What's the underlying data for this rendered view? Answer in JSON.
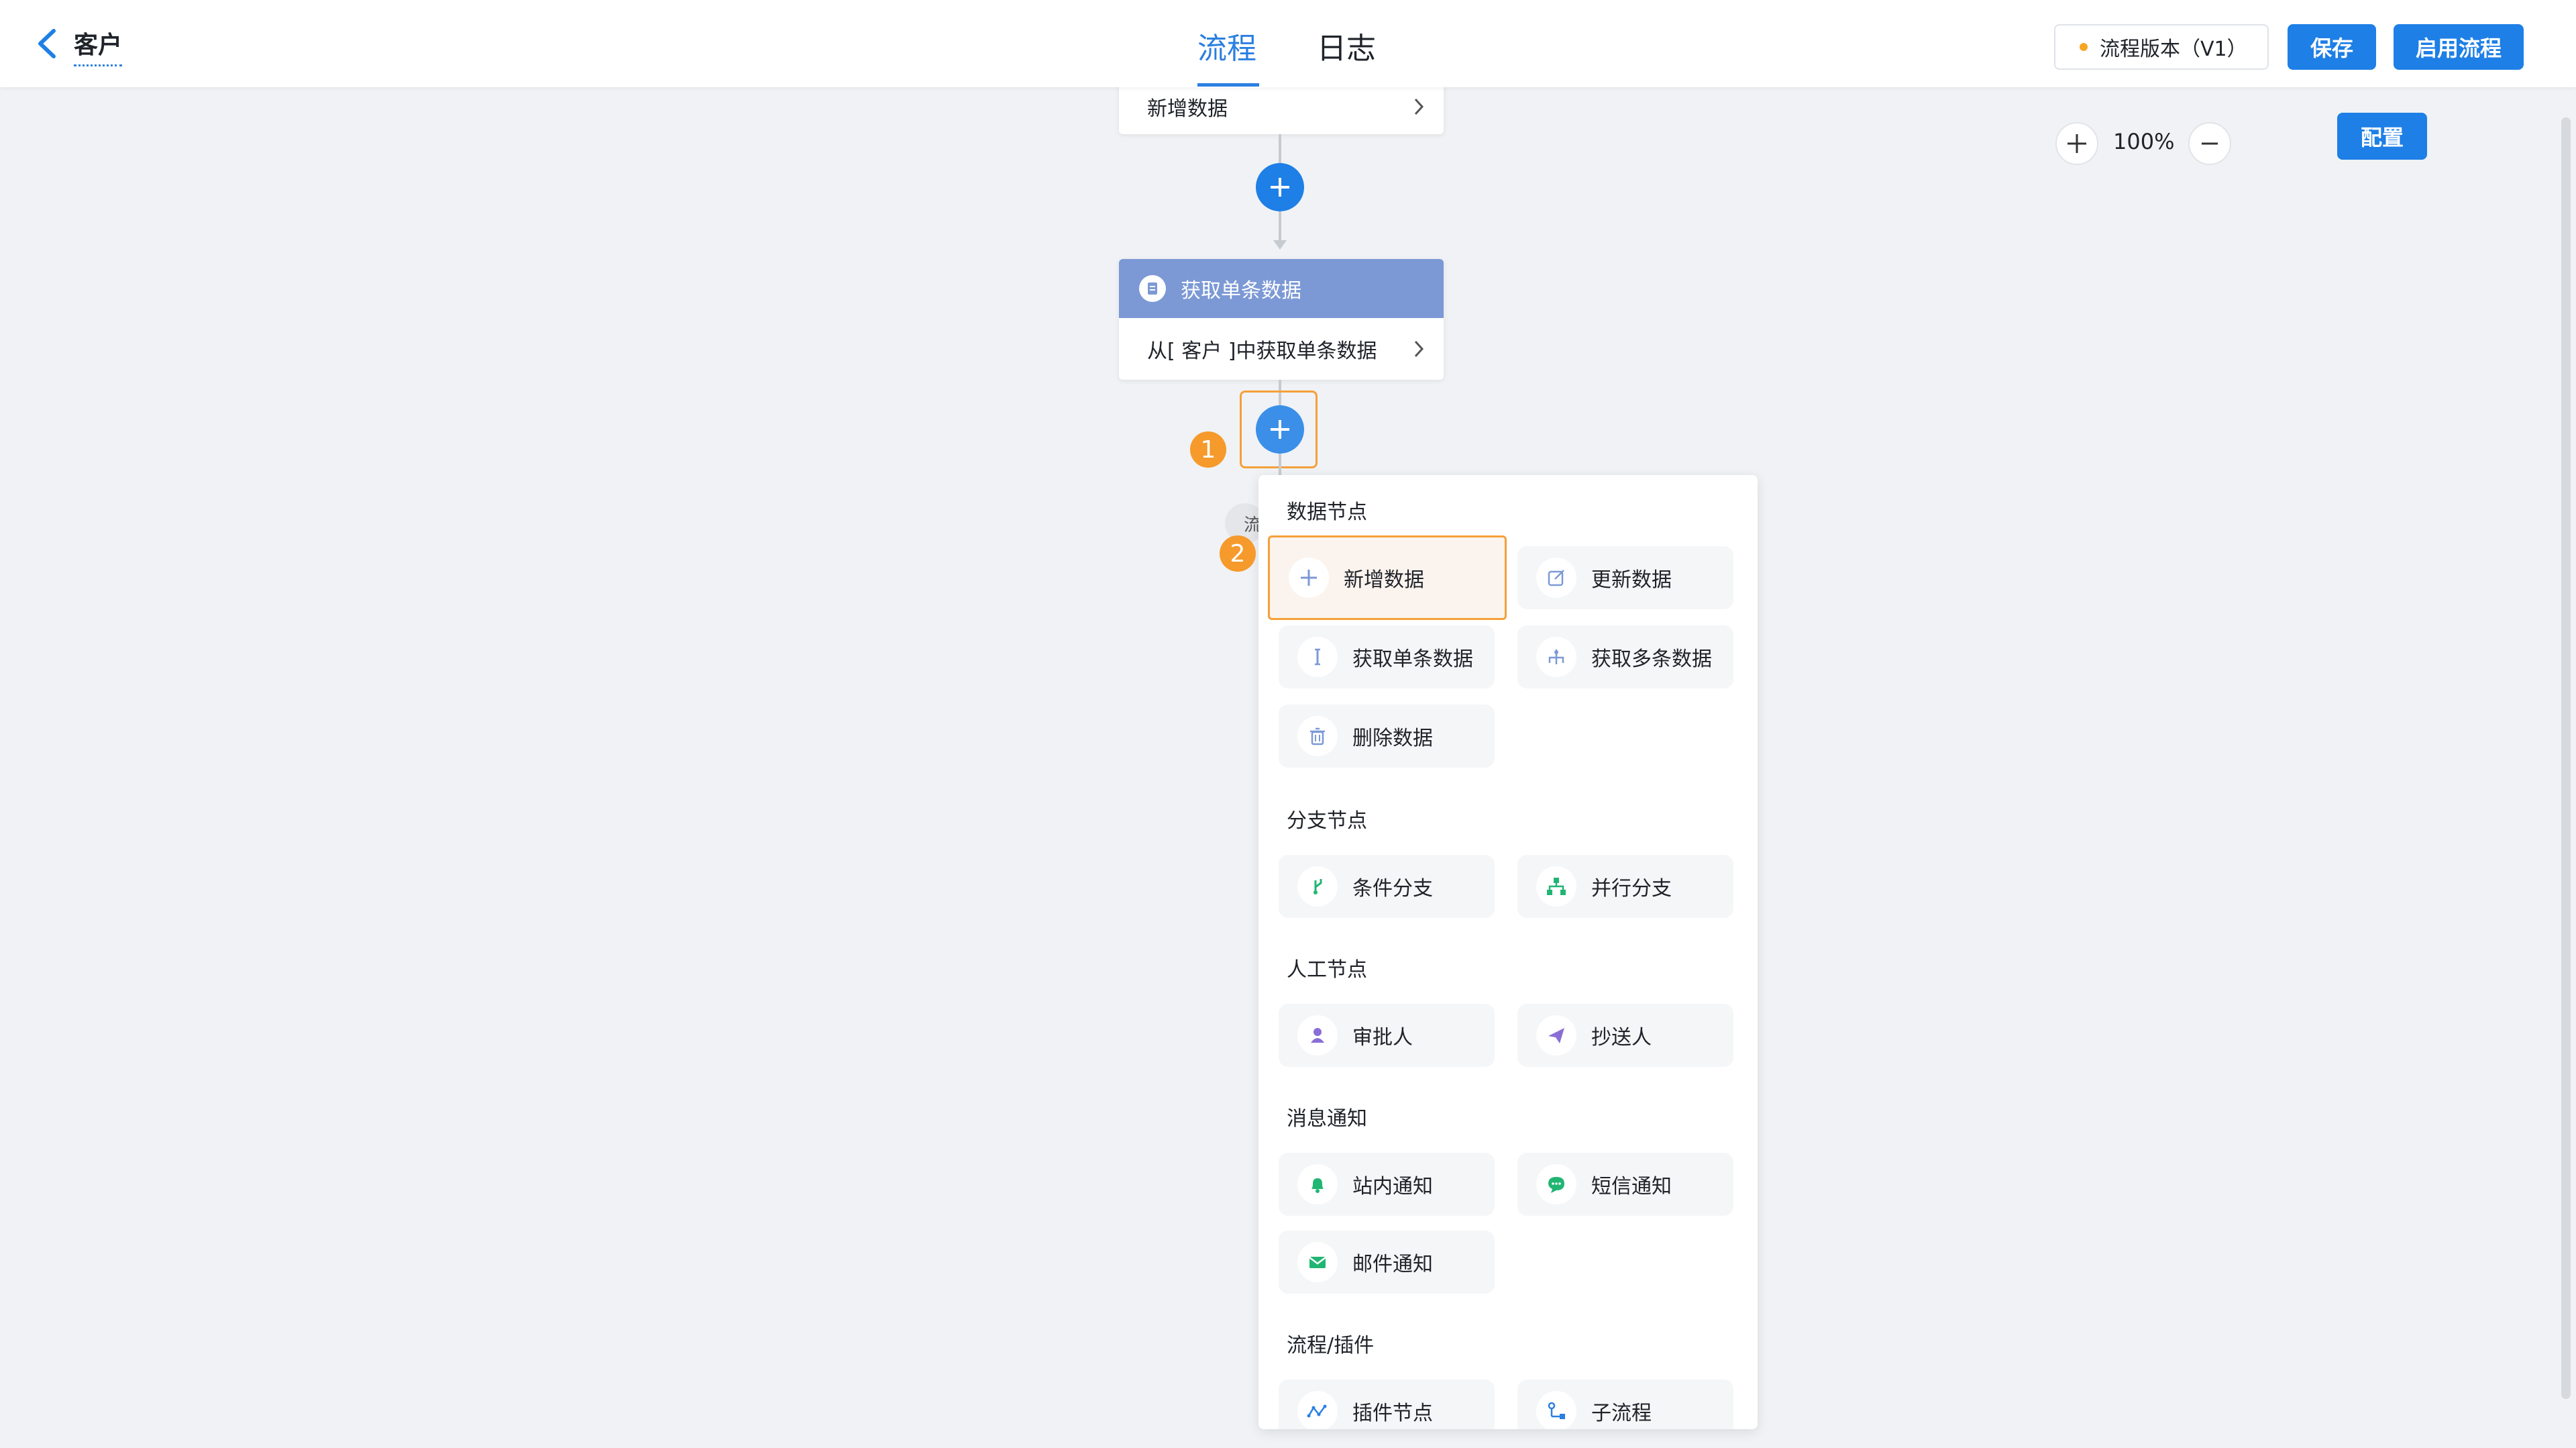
{
  "header": {
    "title": "客户",
    "tabs": [
      {
        "label": "流程"
      },
      {
        "label": "日志"
      }
    ],
    "version": "流程版本（V1）",
    "save_label": "保存",
    "enable_label": "启用流程"
  },
  "canvas": {
    "zoom": "100%",
    "config_label": "配置",
    "nodes": [
      {
        "row": "新增数据"
      },
      {
        "header": "获取单条数据",
        "row": "从[ 客户 ]中获取单条数据"
      }
    ],
    "hidden_label": "流",
    "badges": [
      "1",
      "2"
    ]
  },
  "menu": {
    "sections": [
      {
        "title": "数据节点",
        "items": [
          "新增数据",
          "更新数据",
          "获取单条数据",
          "获取多条数据",
          "删除数据"
        ]
      },
      {
        "title": "分支节点",
        "items": [
          "条件分支",
          "并行分支"
        ]
      },
      {
        "title": "人工节点",
        "items": [
          "审批人",
          "抄送人"
        ]
      },
      {
        "title": "消息通知",
        "items": [
          "站内通知",
          "短信通知",
          "邮件通知"
        ]
      },
      {
        "title": "流程/插件",
        "items": [
          "插件节点",
          "子流程"
        ]
      }
    ]
  },
  "colors": {
    "primary": "#1e7fe6",
    "highlight": "#f5a03a",
    "node_header": "#7c99d6",
    "green": "#21b573",
    "purple": "#8a6ed6"
  }
}
